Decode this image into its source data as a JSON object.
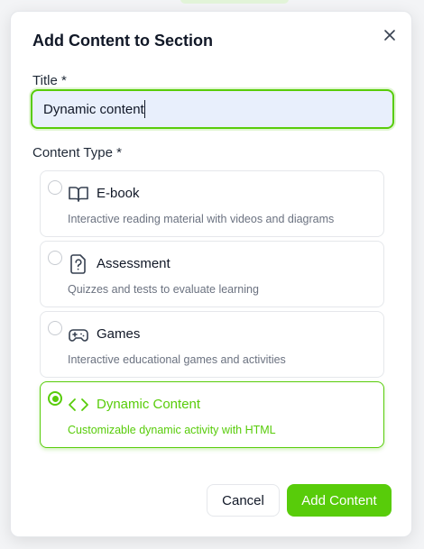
{
  "dialog": {
    "title": "Add Content to Section",
    "close_icon": "close-icon"
  },
  "form": {
    "title_label": "Title *",
    "title_value": "Dynamic content",
    "content_type_label": "Content Type *"
  },
  "options": [
    {
      "name": "E-book",
      "description": "Interactive reading material with videos and diagrams",
      "icon": "book-open-icon",
      "selected": false
    },
    {
      "name": "Assessment",
      "description": "Quizzes and tests to evaluate learning",
      "icon": "question-file-icon",
      "selected": false
    },
    {
      "name": "Games",
      "description": "Interactive educational games and activities",
      "icon": "gamepad-icon",
      "selected": false
    },
    {
      "name": "Dynamic Content",
      "description": "Customizable dynamic activity with HTML",
      "icon": "code-icon",
      "selected": true
    }
  ],
  "footer": {
    "cancel_label": "Cancel",
    "add_label": "Add Content"
  },
  "colors": {
    "accent": "#58cc0a",
    "input_bg": "#e8effc",
    "muted_text": "#6b7280"
  }
}
